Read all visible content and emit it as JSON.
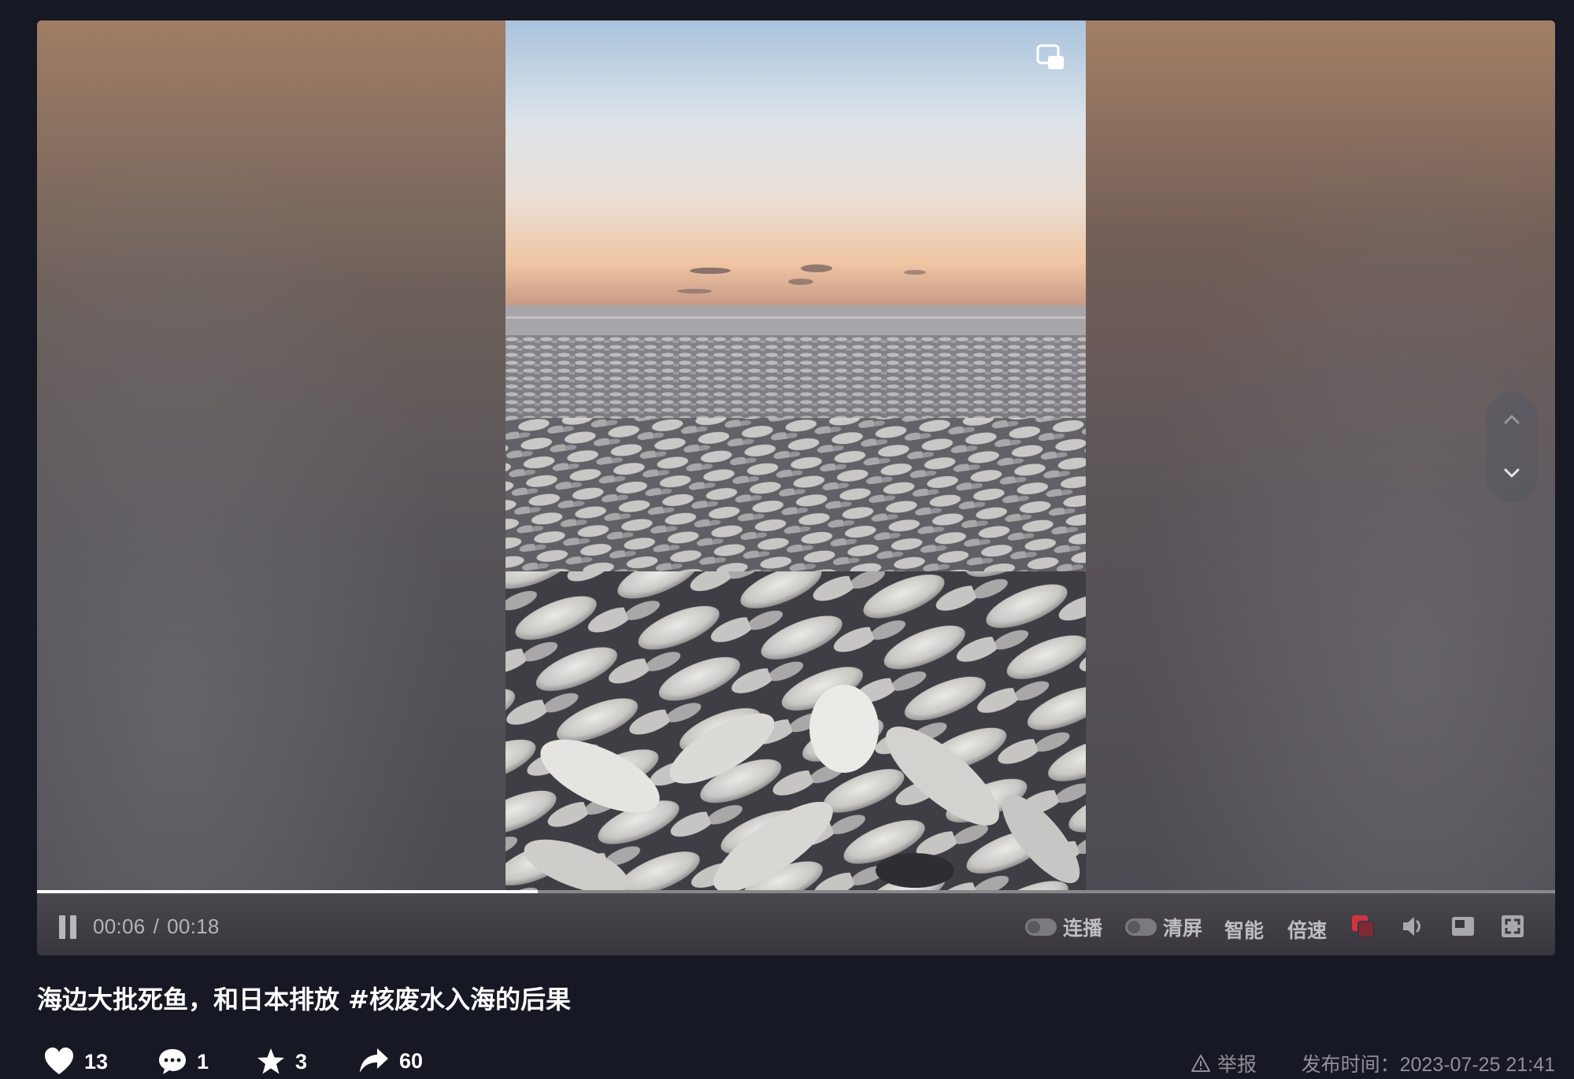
{
  "player": {
    "current_time": "00:06",
    "time_separator": "/",
    "duration": "00:18",
    "progress": 0.33,
    "controls": {
      "autoplay_label": "连播",
      "clear_screen_label": "清屏",
      "smart_label": "智能",
      "speed_label": "倍速"
    },
    "icons": [
      "pause-icon",
      "pip-icon",
      "chevron-up-icon",
      "chevron-down-icon",
      "danmaku-icon",
      "volume-icon",
      "mini-player-icon",
      "fullscreen-icon"
    ]
  },
  "post": {
    "caption": "海边大批死鱼，和日本排放 #核废水入海的后果",
    "likes": "13",
    "comments": "1",
    "favorites": "3",
    "shares": "60",
    "report_label": "举报",
    "publish_time": "发布时间：2023-07-25 21:41"
  },
  "colors": {
    "background": "#161824",
    "control_text": "#bdbdc2",
    "meta_text": "#8e8f98",
    "danmaku_accent": "#d0343f"
  }
}
